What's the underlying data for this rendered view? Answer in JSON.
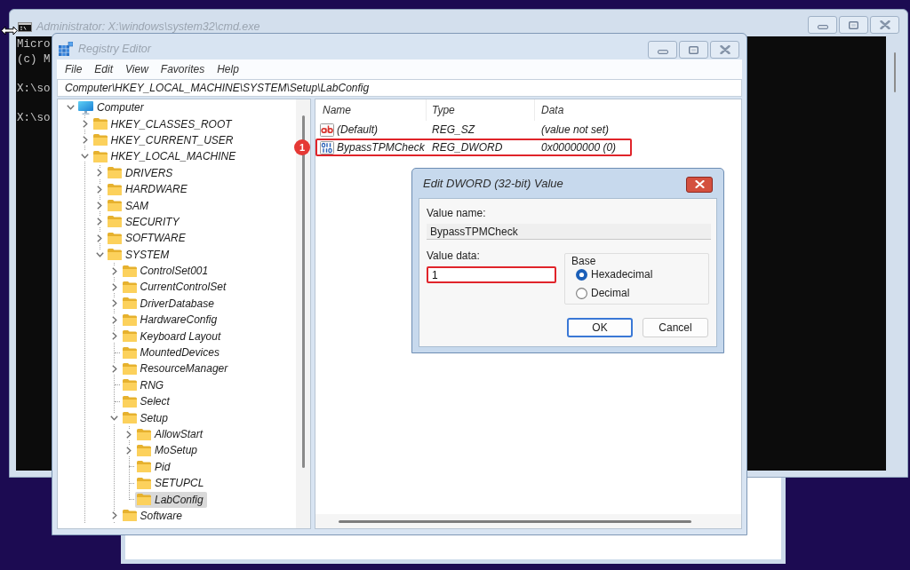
{
  "cmd_window": {
    "title": "Administrator: X:\\windows\\system32\\cmd.exe",
    "console_blocks": [
      [
        "Micro",
        "(c) M"
      ],
      [
        "X:\\so"
      ],
      [
        "X:\\so"
      ]
    ]
  },
  "registry_editor": {
    "title": "Registry Editor",
    "menu": [
      "File",
      "Edit",
      "View",
      "Favorites",
      "Help"
    ],
    "address": "Computer\\HKEY_LOCAL_MACHINE\\SYSTEM\\Setup\\LabConfig",
    "tree": [
      {
        "label": "Computer",
        "kind": "root",
        "expanded": true,
        "selected": false,
        "list_continues": true,
        "children": [
          {
            "label": "HKEY_CLASSES_ROOT",
            "kind": "branch",
            "expanded": false,
            "selected": false
          },
          {
            "label": "HKEY_CURRENT_USER",
            "kind": "branch",
            "expanded": false,
            "selected": false
          },
          {
            "label": "HKEY_LOCAL_MACHINE",
            "kind": "branch",
            "expanded": true,
            "selected": false,
            "list_continues": false,
            "children": [
              {
                "label": "DRIVERS",
                "kind": "branch",
                "expanded": false,
                "selected": false
              },
              {
                "label": "HARDWARE",
                "kind": "branch",
                "expanded": false,
                "selected": false
              },
              {
                "label": "SAM",
                "kind": "branch",
                "expanded": false,
                "selected": false
              },
              {
                "label": "SECURITY",
                "kind": "branch",
                "expanded": false,
                "selected": false
              },
              {
                "label": "SOFTWARE",
                "kind": "branch",
                "expanded": false,
                "selected": false
              },
              {
                "label": "SYSTEM",
                "kind": "branch",
                "expanded": true,
                "selected": false,
                "list_continues": true,
                "children": [
                  {
                    "label": "ControlSet001",
                    "kind": "branch",
                    "expanded": false,
                    "selected": false
                  },
                  {
                    "label": "CurrentControlSet",
                    "kind": "branch",
                    "expanded": false,
                    "selected": false
                  },
                  {
                    "label": "DriverDatabase",
                    "kind": "branch",
                    "expanded": false,
                    "selected": false
                  },
                  {
                    "label": "HardwareConfig",
                    "kind": "branch",
                    "expanded": false,
                    "selected": false
                  },
                  {
                    "label": "Keyboard Layout",
                    "kind": "branch",
                    "expanded": false,
                    "selected": false
                  },
                  {
                    "label": "MountedDevices",
                    "kind": "leaf",
                    "selected": false
                  },
                  {
                    "label": "ResourceManager",
                    "kind": "branch",
                    "expanded": false,
                    "selected": false
                  },
                  {
                    "label": "RNG",
                    "kind": "leaf",
                    "selected": false
                  },
                  {
                    "label": "Select",
                    "kind": "leaf",
                    "selected": false
                  },
                  {
                    "label": "Setup",
                    "kind": "branch",
                    "expanded": true,
                    "selected": false,
                    "list_continues": false,
                    "children": [
                      {
                        "label": "AllowStart",
                        "kind": "branch",
                        "expanded": false,
                        "selected": false
                      },
                      {
                        "label": "MoSetup",
                        "kind": "branch",
                        "expanded": false,
                        "selected": false
                      },
                      {
                        "label": "Pid",
                        "kind": "leaf",
                        "selected": false
                      },
                      {
                        "label": "SETUPCL",
                        "kind": "leaf",
                        "selected": false
                      },
                      {
                        "label": "LabConfig",
                        "kind": "leaf",
                        "selected": true
                      }
                    ]
                  },
                  {
                    "label": "Software",
                    "kind": "branch",
                    "expanded": false,
                    "selected": false
                  }
                ]
              }
            ]
          }
        ]
      }
    ],
    "columns": [
      "Name",
      "Type",
      "Data"
    ],
    "values": [
      {
        "kind": "string",
        "name": "(Default)",
        "type": "REG_SZ",
        "data": "(value not set)",
        "highlighted": false
      },
      {
        "kind": "dword",
        "name": "BypassTPMCheck",
        "type": "REG_DWORD",
        "data": "0x00000000 (0)",
        "highlighted": true,
        "callout": "1"
      }
    ]
  },
  "dialog": {
    "title": "Edit DWORD (32-bit) Value",
    "value_name_label": "Value name:",
    "value_name": "BypassTPMCheck",
    "value_data_label": "Value data:",
    "value_data": "1",
    "value_data_highlighted": true,
    "base_label": "Base",
    "base_options": [
      {
        "label": "Hexadecimal",
        "selected": true
      },
      {
        "label": "Decimal",
        "selected": false
      }
    ],
    "buttons": [
      {
        "label": "OK",
        "default": true
      },
      {
        "label": "Cancel",
        "default": false
      }
    ]
  }
}
